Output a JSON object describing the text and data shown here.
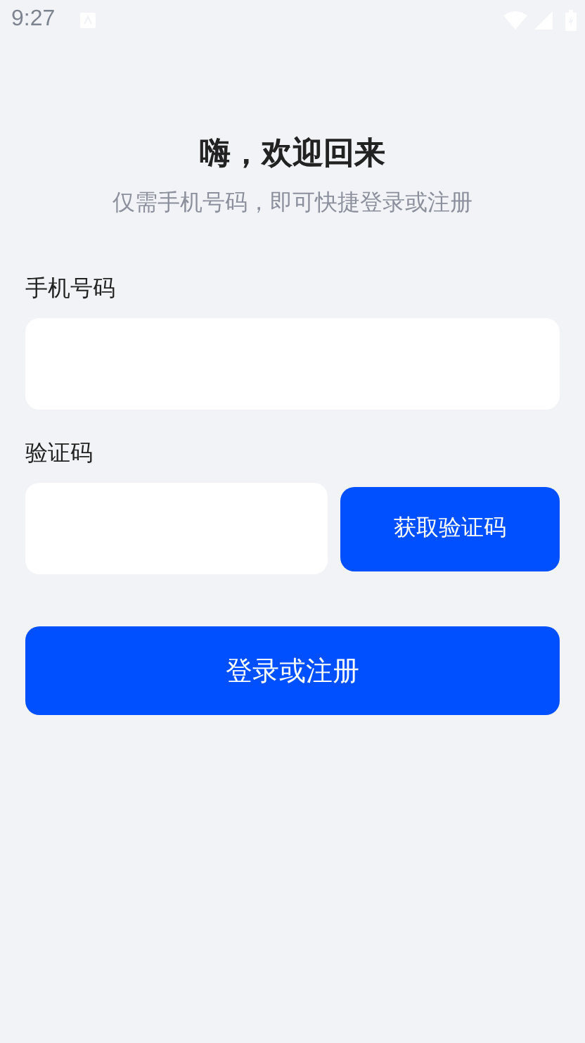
{
  "status_bar": {
    "time": "9:27"
  },
  "title": "嗨，欢迎回来",
  "subtitle": "仅需手机号码，即可快捷登录或注册",
  "phone_field": {
    "label": "手机号码"
  },
  "code_field": {
    "label": "验证码"
  },
  "get_code_button": "获取验证码",
  "login_button": "登录或注册"
}
